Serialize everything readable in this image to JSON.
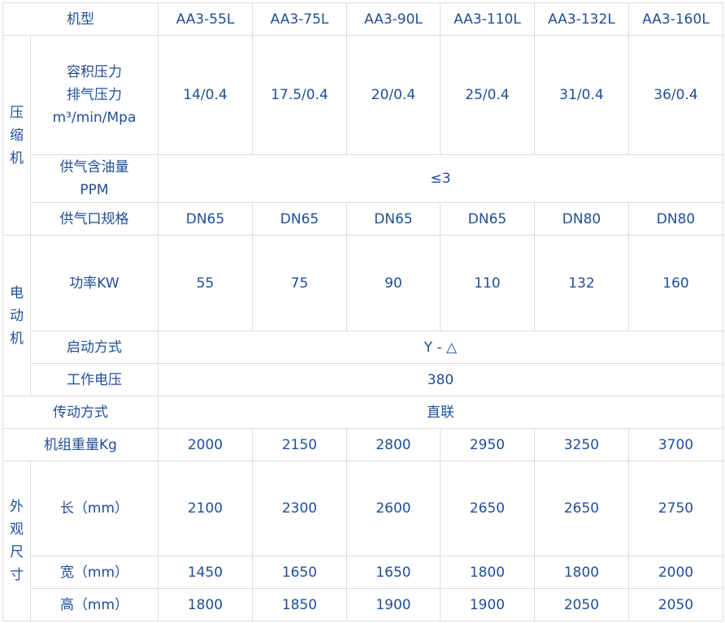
{
  "header": {
    "label": "机型",
    "models": [
      "AA3-55L",
      "AA3-75L",
      "AA3-90L",
      "AA3-110L",
      "AA3-132L",
      "AA3-160L"
    ]
  },
  "compressor": {
    "group": [
      "压",
      "缩",
      "机"
    ],
    "flow_label": [
      "容积压力",
      "排气压力",
      "m³/min/Mpa"
    ],
    "flow": [
      "14/0.4",
      "17.5/0.4",
      "20/0.4",
      "25/0.4",
      "31/0.4",
      "36/0.4"
    ],
    "oil_label": [
      "供气含油量",
      "PPM"
    ],
    "oil": "≤3",
    "outlet_label": "供气口规格",
    "outlet": [
      "DN65",
      "DN65",
      "DN65",
      "DN65",
      "DN80",
      "DN80"
    ]
  },
  "motor": {
    "group": [
      "电",
      "动",
      "机"
    ],
    "power_label": "功率KW",
    "power": [
      "55",
      "75",
      "90",
      "110",
      "132",
      "160"
    ],
    "start_label": "启动方式",
    "start": "Y - △",
    "voltage_label": "工作电压",
    "voltage": "380"
  },
  "drive": {
    "label": "传动方式",
    "value": "直联"
  },
  "weight": {
    "label": "机组重量Kg",
    "values": [
      "2000",
      "2150",
      "2800",
      "2950",
      "3250",
      "3700"
    ]
  },
  "dimensions": {
    "group": [
      "外",
      "观",
      "尺",
      "寸"
    ],
    "length_label": "长（mm）",
    "length": [
      "2100",
      "2300",
      "2600",
      "2650",
      "2650",
      "2750"
    ],
    "width_label": "宽（mm）",
    "width": [
      "1450",
      "1650",
      "1650",
      "1800",
      "1800",
      "2000"
    ],
    "height_label": "高（mm）",
    "height": [
      "1800",
      "1850",
      "1900",
      "1900",
      "2050",
      "2050"
    ]
  }
}
